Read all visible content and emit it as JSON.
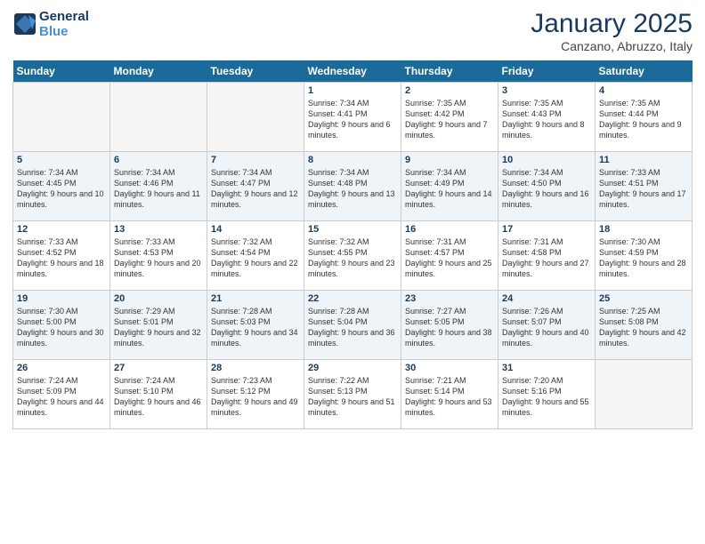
{
  "logo": {
    "line1": "General",
    "line2": "Blue"
  },
  "title": "January 2025",
  "subtitle": "Canzano, Abruzzo, Italy",
  "weekdays": [
    "Sunday",
    "Monday",
    "Tuesday",
    "Wednesday",
    "Thursday",
    "Friday",
    "Saturday"
  ],
  "weeks": [
    {
      "alt": false,
      "days": [
        {
          "num": "",
          "content": ""
        },
        {
          "num": "",
          "content": ""
        },
        {
          "num": "",
          "content": ""
        },
        {
          "num": "1",
          "content": "Sunrise: 7:34 AM\nSunset: 4:41 PM\nDaylight: 9 hours and 6 minutes."
        },
        {
          "num": "2",
          "content": "Sunrise: 7:35 AM\nSunset: 4:42 PM\nDaylight: 9 hours and 7 minutes."
        },
        {
          "num": "3",
          "content": "Sunrise: 7:35 AM\nSunset: 4:43 PM\nDaylight: 9 hours and 8 minutes."
        },
        {
          "num": "4",
          "content": "Sunrise: 7:35 AM\nSunset: 4:44 PM\nDaylight: 9 hours and 9 minutes."
        }
      ]
    },
    {
      "alt": true,
      "days": [
        {
          "num": "5",
          "content": "Sunrise: 7:34 AM\nSunset: 4:45 PM\nDaylight: 9 hours and 10 minutes."
        },
        {
          "num": "6",
          "content": "Sunrise: 7:34 AM\nSunset: 4:46 PM\nDaylight: 9 hours and 11 minutes."
        },
        {
          "num": "7",
          "content": "Sunrise: 7:34 AM\nSunset: 4:47 PM\nDaylight: 9 hours and 12 minutes."
        },
        {
          "num": "8",
          "content": "Sunrise: 7:34 AM\nSunset: 4:48 PM\nDaylight: 9 hours and 13 minutes."
        },
        {
          "num": "9",
          "content": "Sunrise: 7:34 AM\nSunset: 4:49 PM\nDaylight: 9 hours and 14 minutes."
        },
        {
          "num": "10",
          "content": "Sunrise: 7:34 AM\nSunset: 4:50 PM\nDaylight: 9 hours and 16 minutes."
        },
        {
          "num": "11",
          "content": "Sunrise: 7:33 AM\nSunset: 4:51 PM\nDaylight: 9 hours and 17 minutes."
        }
      ]
    },
    {
      "alt": false,
      "days": [
        {
          "num": "12",
          "content": "Sunrise: 7:33 AM\nSunset: 4:52 PM\nDaylight: 9 hours and 18 minutes."
        },
        {
          "num": "13",
          "content": "Sunrise: 7:33 AM\nSunset: 4:53 PM\nDaylight: 9 hours and 20 minutes."
        },
        {
          "num": "14",
          "content": "Sunrise: 7:32 AM\nSunset: 4:54 PM\nDaylight: 9 hours and 22 minutes."
        },
        {
          "num": "15",
          "content": "Sunrise: 7:32 AM\nSunset: 4:55 PM\nDaylight: 9 hours and 23 minutes."
        },
        {
          "num": "16",
          "content": "Sunrise: 7:31 AM\nSunset: 4:57 PM\nDaylight: 9 hours and 25 minutes."
        },
        {
          "num": "17",
          "content": "Sunrise: 7:31 AM\nSunset: 4:58 PM\nDaylight: 9 hours and 27 minutes."
        },
        {
          "num": "18",
          "content": "Sunrise: 7:30 AM\nSunset: 4:59 PM\nDaylight: 9 hours and 28 minutes."
        }
      ]
    },
    {
      "alt": true,
      "days": [
        {
          "num": "19",
          "content": "Sunrise: 7:30 AM\nSunset: 5:00 PM\nDaylight: 9 hours and 30 minutes."
        },
        {
          "num": "20",
          "content": "Sunrise: 7:29 AM\nSunset: 5:01 PM\nDaylight: 9 hours and 32 minutes."
        },
        {
          "num": "21",
          "content": "Sunrise: 7:28 AM\nSunset: 5:03 PM\nDaylight: 9 hours and 34 minutes."
        },
        {
          "num": "22",
          "content": "Sunrise: 7:28 AM\nSunset: 5:04 PM\nDaylight: 9 hours and 36 minutes."
        },
        {
          "num": "23",
          "content": "Sunrise: 7:27 AM\nSunset: 5:05 PM\nDaylight: 9 hours and 38 minutes."
        },
        {
          "num": "24",
          "content": "Sunrise: 7:26 AM\nSunset: 5:07 PM\nDaylight: 9 hours and 40 minutes."
        },
        {
          "num": "25",
          "content": "Sunrise: 7:25 AM\nSunset: 5:08 PM\nDaylight: 9 hours and 42 minutes."
        }
      ]
    },
    {
      "alt": false,
      "days": [
        {
          "num": "26",
          "content": "Sunrise: 7:24 AM\nSunset: 5:09 PM\nDaylight: 9 hours and 44 minutes."
        },
        {
          "num": "27",
          "content": "Sunrise: 7:24 AM\nSunset: 5:10 PM\nDaylight: 9 hours and 46 minutes."
        },
        {
          "num": "28",
          "content": "Sunrise: 7:23 AM\nSunset: 5:12 PM\nDaylight: 9 hours and 49 minutes."
        },
        {
          "num": "29",
          "content": "Sunrise: 7:22 AM\nSunset: 5:13 PM\nDaylight: 9 hours and 51 minutes."
        },
        {
          "num": "30",
          "content": "Sunrise: 7:21 AM\nSunset: 5:14 PM\nDaylight: 9 hours and 53 minutes."
        },
        {
          "num": "31",
          "content": "Sunrise: 7:20 AM\nSunset: 5:16 PM\nDaylight: 9 hours and 55 minutes."
        },
        {
          "num": "",
          "content": ""
        }
      ]
    }
  ]
}
